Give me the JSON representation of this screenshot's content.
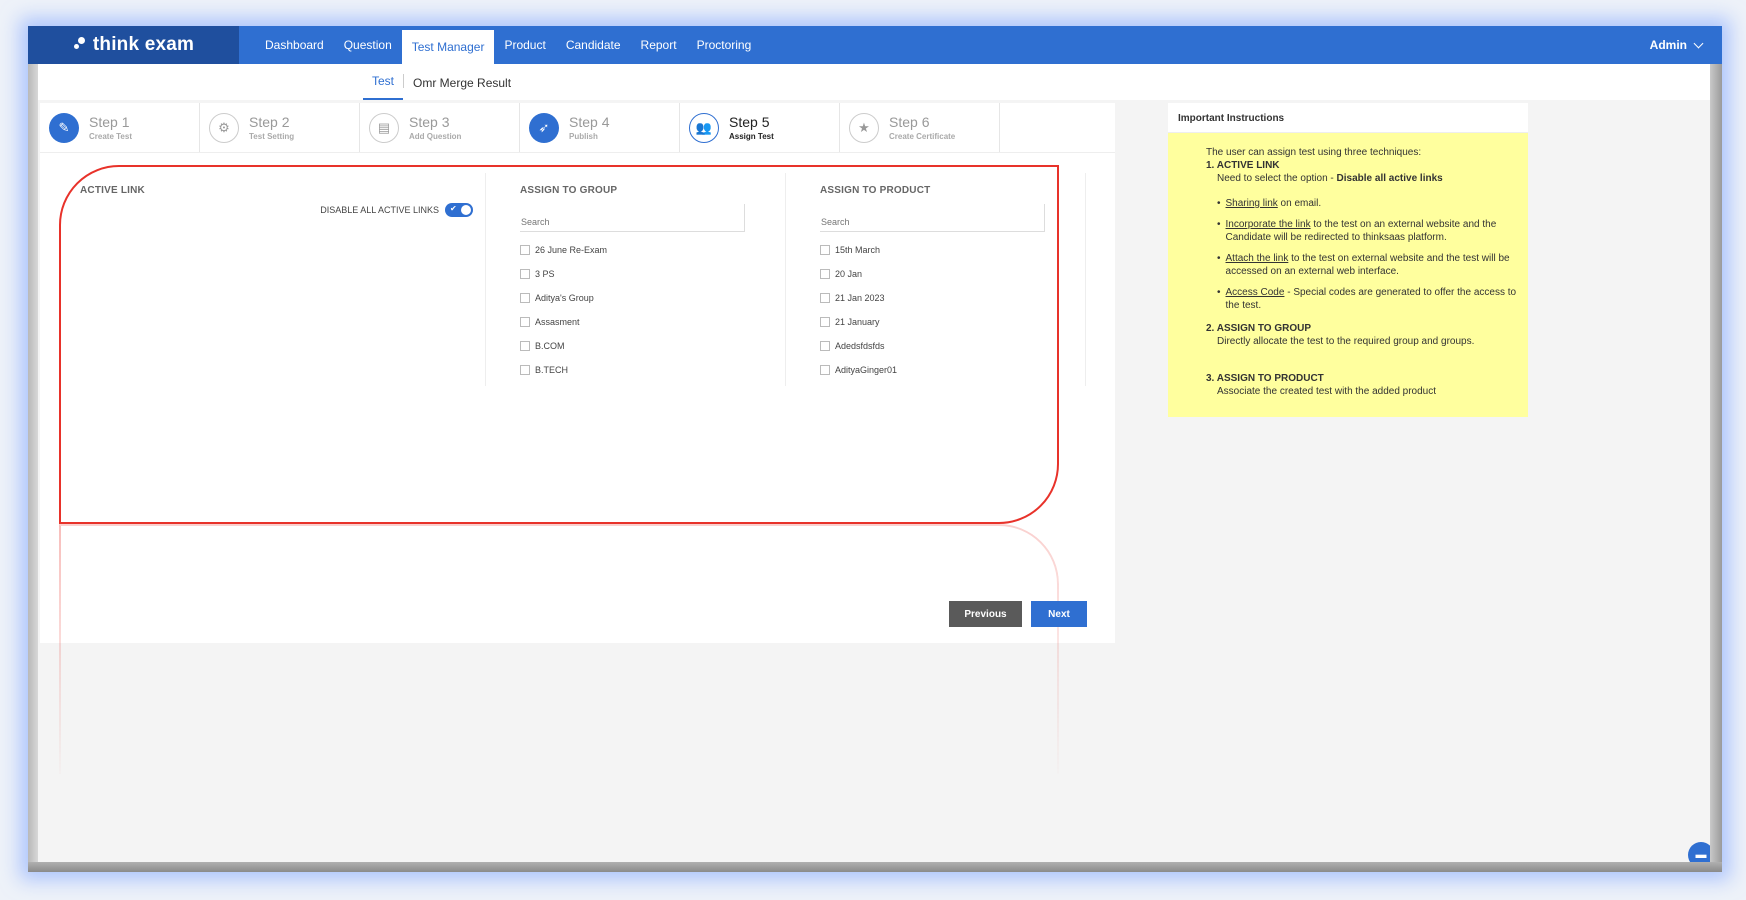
{
  "app": {
    "logo_text": "think exam"
  },
  "nav": {
    "items": [
      "Dashboard",
      "Question",
      "Test Manager",
      "Product",
      "Candidate",
      "Report",
      "Proctoring"
    ],
    "active": "Test Manager",
    "user": "Admin"
  },
  "subnav": {
    "tabs": [
      "Test",
      "Omr Merge Result"
    ],
    "active": "Test"
  },
  "steps": [
    {
      "title": "Step 1",
      "sub": "Create Test",
      "icon": "pencil-icon",
      "glyph": "✎",
      "state": "filled"
    },
    {
      "title": "Step 2",
      "sub": "Test Setting",
      "icon": "gear-icon",
      "glyph": "⚙",
      "state": "outline"
    },
    {
      "title": "Step 3",
      "sub": "Add Question",
      "icon": "document-icon",
      "glyph": "▤",
      "state": "outline"
    },
    {
      "title": "Step 4",
      "sub": "Publish",
      "icon": "rocket-icon",
      "glyph": "➶",
      "state": "filled"
    },
    {
      "title": "Step 5",
      "sub": "Assign Test",
      "icon": "users-icon",
      "glyph": "👥",
      "state": "current"
    },
    {
      "title": "Step 6",
      "sub": "Create Certificate",
      "icon": "star-icon",
      "glyph": "★",
      "state": "outline"
    }
  ],
  "active_link": {
    "title": "ACTIVE LINK",
    "toggle_label": "DISABLE ALL ACTIVE LINKS",
    "toggle_on": true
  },
  "assign_group": {
    "title": "ASSIGN TO GROUP",
    "search_placeholder": "Search",
    "items": [
      "26 June Re-Exam",
      "3 PS",
      "Aditya's Group",
      "Assasment",
      "B.COM",
      "B.TECH"
    ]
  },
  "assign_product": {
    "title": "ASSIGN TO PRODUCT",
    "search_placeholder": "Search",
    "items": [
      "15th March",
      "20 Jan",
      "21 Jan 2023",
      "21 January",
      "Adedsfdsfds",
      "AdityaGinger01"
    ]
  },
  "buttons": {
    "previous": "Previous",
    "next": "Next"
  },
  "instructions": {
    "heading": "Important Instructions",
    "intro": "The user can assign test using three techniques:",
    "s1_title": "1. ACTIVE LINK",
    "s1_desc_prefix": "Need to select the option - ",
    "s1_desc_bold": "Disable all active links",
    "b1_link": "Sharing link",
    "b1_text": " on email.",
    "b2_link": "Incorporate the link",
    "b2_text": " to the test on an external website and the Candidate will be redirected to thinksaas platform.",
    "b3_link": "Attach the link",
    "b3_text": " to the test on external website and the test will be accessed on an external web interface.",
    "b4_link": "Access Code",
    "b4_text": " - Special codes are generated to offer the access to the test.",
    "s2_title": "2. ASSIGN TO GROUP",
    "s2_desc": "Directly allocate the test to the required group and groups.",
    "s3_title": "3. ASSIGN TO PRODUCT",
    "s3_desc": "Associate the created test with the added product"
  },
  "colors": {
    "primary": "#2f6fd1",
    "logo_bg": "#1f4f9e",
    "highlight": "#e8322a",
    "instruction_bg": "#ffff9e"
  }
}
